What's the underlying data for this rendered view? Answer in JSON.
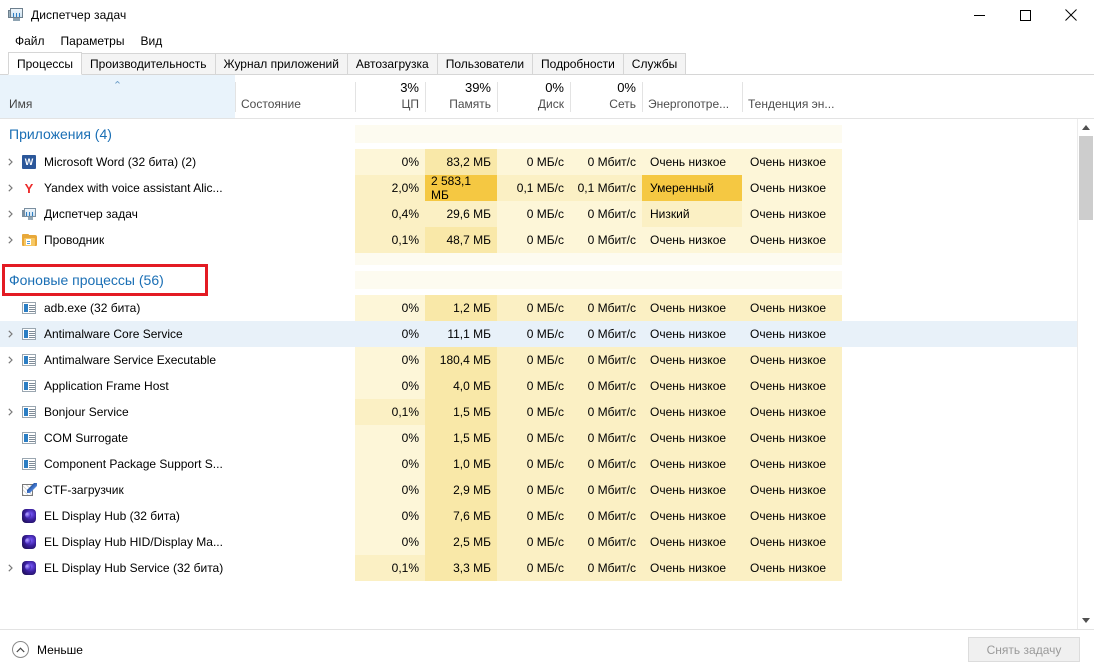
{
  "window": {
    "title": "Диспетчер задач",
    "icon": "task-manager-icon",
    "minimize": "—",
    "maximize": "☐",
    "close": "✕"
  },
  "menu": {
    "items": [
      {
        "label": "Файл"
      },
      {
        "label": "Параметры"
      },
      {
        "label": "Вид"
      }
    ]
  },
  "tabs": [
    {
      "label": "Процессы",
      "active": true
    },
    {
      "label": "Производительность",
      "active": false
    },
    {
      "label": "Журнал приложений",
      "active": false
    },
    {
      "label": "Автозагрузка",
      "active": false
    },
    {
      "label": "Пользователи",
      "active": false
    },
    {
      "label": "Подробности",
      "active": false
    },
    {
      "label": "Службы",
      "active": false
    }
  ],
  "columns": [
    {
      "key": "name",
      "label": "Имя",
      "summary": "",
      "sorted": true,
      "sort_dir": "asc"
    },
    {
      "key": "state",
      "label": "Состояние",
      "summary": ""
    },
    {
      "key": "cpu",
      "label": "ЦП",
      "summary": "3%"
    },
    {
      "key": "memory",
      "label": "Память",
      "summary": "39%"
    },
    {
      "key": "disk",
      "label": "Диск",
      "summary": "0%"
    },
    {
      "key": "net",
      "label": "Сеть",
      "summary": "0%"
    },
    {
      "key": "power",
      "label": "Энергопотре...",
      "summary": ""
    },
    {
      "key": "powertrend",
      "label": "Тенденция эн...",
      "summary": ""
    }
  ],
  "groups": [
    {
      "label": "Приложения (4)",
      "count": 4,
      "highlighted": false
    },
    {
      "label": "Фоновые процессы (56)",
      "count": 56,
      "highlighted": true
    }
  ],
  "apps": [
    {
      "name": "Microsoft Word (32 бита) (2)",
      "icon": "word-icon",
      "expandable": true,
      "state": "",
      "cpu": "0%",
      "memory": "83,2 МБ",
      "disk": "0 МБ/с",
      "net": "0 Мбит/с",
      "power": "Очень низкое",
      "powertrend": "Очень низкое",
      "heat": {
        "cpu": 1,
        "memory": 3,
        "disk": 1,
        "net": 1,
        "power": 1,
        "powertrend": 1
      }
    },
    {
      "name": "Yandex with voice assistant Alic...",
      "icon": "yandex-icon",
      "expandable": true,
      "state": "",
      "cpu": "2,0%",
      "memory": "2 583,1 МБ",
      "disk": "0,1 МБ/с",
      "net": "0,1 Мбит/с",
      "power": "Умеренный",
      "powertrend": "Очень низкое",
      "heat": {
        "cpu": 2,
        "memory": 5,
        "disk": 2,
        "net": 2,
        "power": 5,
        "powertrend": 1
      }
    },
    {
      "name": "Диспетчер задач",
      "icon": "task-manager-icon",
      "expandable": true,
      "state": "",
      "cpu": "0,4%",
      "memory": "29,6 МБ",
      "disk": "0 МБ/с",
      "net": "0 Мбит/с",
      "power": "Низкий",
      "powertrend": "Очень низкое",
      "heat": {
        "cpu": 2,
        "memory": 2,
        "disk": 1,
        "net": 1,
        "power": 2,
        "powertrend": 1
      }
    },
    {
      "name": "Проводник",
      "icon": "folder-icon",
      "expandable": true,
      "state": "",
      "cpu": "0,1%",
      "memory": "48,7 МБ",
      "disk": "0 МБ/с",
      "net": "0 Мбит/с",
      "power": "Очень низкое",
      "powertrend": "Очень низкое",
      "heat": {
        "cpu": 2,
        "memory": 3,
        "disk": 1,
        "net": 1,
        "power": 1,
        "powertrend": 1
      }
    }
  ],
  "background": [
    {
      "name": "adb.exe (32 бита)",
      "icon": "generic-process-icon",
      "expandable": false,
      "selected": false,
      "state": "",
      "cpu": "0%",
      "memory": "1,2 МБ",
      "disk": "0 МБ/с",
      "net": "0 Мбит/с",
      "power": "Очень низкое",
      "powertrend": "Очень низкое",
      "heat": {
        "cpu": 1,
        "memory": 3,
        "disk": 2,
        "net": 2,
        "power": 2,
        "powertrend": 2
      }
    },
    {
      "name": "Antimalware Core Service",
      "icon": "generic-process-icon",
      "expandable": true,
      "selected": true,
      "state": "",
      "cpu": "0%",
      "memory": "11,1 МБ",
      "disk": "0 МБ/с",
      "net": "0 Мбит/с",
      "power": "Очень низкое",
      "powertrend": "Очень низкое",
      "heat": {
        "cpu": 1,
        "memory": 3,
        "disk": 2,
        "net": 2,
        "power": 2,
        "powertrend": 2
      }
    },
    {
      "name": "Antimalware Service Executable",
      "icon": "generic-process-icon",
      "expandable": true,
      "selected": false,
      "state": "",
      "cpu": "0%",
      "memory": "180,4 МБ",
      "disk": "0 МБ/с",
      "net": "0 Мбит/с",
      "power": "Очень низкое",
      "powertrend": "Очень низкое",
      "heat": {
        "cpu": 1,
        "memory": 3,
        "disk": 2,
        "net": 2,
        "power": 2,
        "powertrend": 2
      }
    },
    {
      "name": "Application Frame Host",
      "icon": "generic-process-icon",
      "expandable": false,
      "selected": false,
      "state": "",
      "cpu": "0%",
      "memory": "4,0 МБ",
      "disk": "0 МБ/с",
      "net": "0 Мбит/с",
      "power": "Очень низкое",
      "powertrend": "Очень низкое",
      "heat": {
        "cpu": 1,
        "memory": 3,
        "disk": 2,
        "net": 2,
        "power": 2,
        "powertrend": 2
      }
    },
    {
      "name": "Bonjour Service",
      "icon": "generic-process-icon",
      "expandable": true,
      "selected": false,
      "state": "",
      "cpu": "0,1%",
      "memory": "1,5 МБ",
      "disk": "0 МБ/с",
      "net": "0 Мбит/с",
      "power": "Очень низкое",
      "powertrend": "Очень низкое",
      "heat": {
        "cpu": 2,
        "memory": 3,
        "disk": 2,
        "net": 2,
        "power": 2,
        "powertrend": 2
      }
    },
    {
      "name": "COM Surrogate",
      "icon": "generic-process-icon",
      "expandable": false,
      "selected": false,
      "state": "",
      "cpu": "0%",
      "memory": "1,5 МБ",
      "disk": "0 МБ/с",
      "net": "0 Мбит/с",
      "power": "Очень низкое",
      "powertrend": "Очень низкое",
      "heat": {
        "cpu": 1,
        "memory": 3,
        "disk": 2,
        "net": 2,
        "power": 2,
        "powertrend": 2
      }
    },
    {
      "name": "Component Package Support S...",
      "icon": "generic-process-icon",
      "expandable": false,
      "selected": false,
      "state": "",
      "cpu": "0%",
      "memory": "1,0 МБ",
      "disk": "0 МБ/с",
      "net": "0 Мбит/с",
      "power": "Очень низкое",
      "powertrend": "Очень низкое",
      "heat": {
        "cpu": 1,
        "memory": 3,
        "disk": 2,
        "net": 2,
        "power": 2,
        "powertrend": 2
      }
    },
    {
      "name": "CTF-загрузчик",
      "icon": "ctf-loader-icon",
      "expandable": false,
      "selected": false,
      "state": "",
      "cpu": "0%",
      "memory": "2,9 МБ",
      "disk": "0 МБ/с",
      "net": "0 Мбит/с",
      "power": "Очень низкое",
      "powertrend": "Очень низкое",
      "heat": {
        "cpu": 1,
        "memory": 3,
        "disk": 2,
        "net": 2,
        "power": 2,
        "powertrend": 2
      }
    },
    {
      "name": "EL Display Hub (32 бита)",
      "icon": "el-display-hub-icon",
      "expandable": false,
      "selected": false,
      "state": "",
      "cpu": "0%",
      "memory": "7,6 МБ",
      "disk": "0 МБ/с",
      "net": "0 Мбит/с",
      "power": "Очень низкое",
      "powertrend": "Очень низкое",
      "heat": {
        "cpu": 1,
        "memory": 3,
        "disk": 2,
        "net": 2,
        "power": 2,
        "powertrend": 2
      }
    },
    {
      "name": "EL Display Hub HID/Display Ma...",
      "icon": "el-display-hub-icon",
      "expandable": false,
      "selected": false,
      "state": "",
      "cpu": "0%",
      "memory": "2,5 МБ",
      "disk": "0 МБ/с",
      "net": "0 Мбит/с",
      "power": "Очень низкое",
      "powertrend": "Очень низкое",
      "heat": {
        "cpu": 1,
        "memory": 3,
        "disk": 2,
        "net": 2,
        "power": 2,
        "powertrend": 2
      }
    },
    {
      "name": "EL Display Hub Service (32 бита)",
      "icon": "el-display-hub-icon",
      "expandable": true,
      "selected": false,
      "state": "",
      "cpu": "0,1%",
      "memory": "3,3 МБ",
      "disk": "0 МБ/с",
      "net": "0 Мбит/с",
      "power": "Очень низкое",
      "powertrend": "Очень низкое",
      "heat": {
        "cpu": 2,
        "memory": 3,
        "disk": 2,
        "net": 2,
        "power": 2,
        "powertrend": 2
      }
    }
  ],
  "statusbar": {
    "less_label": "Меньше",
    "less_icon": "chevron-up-circle-icon",
    "end_task_label": "Снять задачу",
    "end_task_enabled": false
  },
  "annotation": {
    "color": "#e31b23",
    "target": "Фоновые процессы (56)"
  },
  "scrollbar": {
    "up_arrow": "▲",
    "down_arrow": "▼",
    "position": "top"
  }
}
